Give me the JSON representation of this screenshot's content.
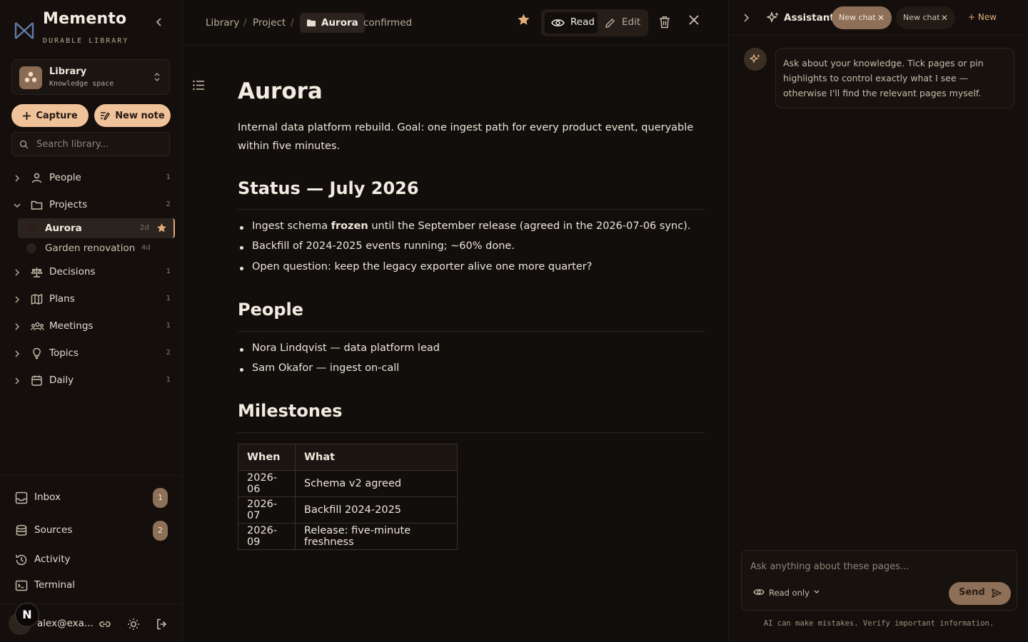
{
  "app": {
    "name": "Memento",
    "subtitle": "DURABLE LIBRARY"
  },
  "space": {
    "name": "Library",
    "type": "Knowledge space"
  },
  "actions": {
    "capture": "Capture",
    "new_note": "New note"
  },
  "search": {
    "placeholder": "Search library..."
  },
  "tree": {
    "people": {
      "label": "People",
      "count": "1"
    },
    "projects": {
      "label": "Projects",
      "count": "2"
    },
    "project_items": [
      {
        "label": "Aurora",
        "age": "2d"
      },
      {
        "label": "Garden renovation",
        "age": "4d"
      }
    ],
    "decisions": {
      "label": "Decisions",
      "count": "1"
    },
    "plans": {
      "label": "Plans",
      "count": "1"
    },
    "meetings": {
      "label": "Meetings",
      "count": "1"
    },
    "topics": {
      "label": "Topics",
      "count": "2"
    },
    "daily": {
      "label": "Daily",
      "count": "1"
    }
  },
  "bottom_nav": {
    "inbox": {
      "label": "Inbox",
      "badge": "1"
    },
    "sources": {
      "label": "Sources",
      "badge": "2"
    },
    "activity": {
      "label": "Activity"
    },
    "terminal": {
      "label": "Terminal"
    }
  },
  "user": {
    "email": "alex@exa...",
    "initial": "N"
  },
  "breadcrumb": {
    "library": "Library",
    "project": "Project",
    "current": "Aurora",
    "status": "confirmed"
  },
  "view_toggle": {
    "read": "Read",
    "edit": "Edit"
  },
  "document": {
    "title": "Aurora",
    "intro": "Internal data platform rebuild. Goal: one ingest path for every product event, queryable within five minutes.",
    "status_heading": "Status — July 2026",
    "status_items": [
      {
        "before": "Ingest schema ",
        "bold": "frozen",
        "after": " until the September release (agreed in the 2026-07-06 sync)."
      },
      {
        "before": "Backfill of 2024-2025 events running; ~60% done.",
        "bold": "",
        "after": ""
      },
      {
        "before": "Open question: keep the legacy exporter alive one more quarter?",
        "bold": "",
        "after": ""
      }
    ],
    "people_heading": "People",
    "people_items": [
      "Nora Lindqvist — data platform lead",
      "Sam Okafor — ingest on-call"
    ],
    "milestones_heading": "Milestones",
    "milestones_table": {
      "headers": [
        "When",
        "What"
      ],
      "rows": [
        [
          "2026-06",
          "Schema v2 agreed"
        ],
        [
          "2026-07",
          "Backfill 2024-2025"
        ],
        [
          "2026-09",
          "Release: five-minute freshness"
        ]
      ]
    }
  },
  "assistant": {
    "title": "Assistant",
    "tabs": [
      "New chat",
      "New chat"
    ],
    "new_label": "New",
    "greeting": "Ask about your knowledge. Tick pages or pin highlights to control exactly what I see — otherwise I'll find the relevant pages myself.",
    "input_placeholder": "Ask anything about these pages...",
    "mode": "Read only",
    "send": "Send",
    "disclaimer": "AI can make mistakes. Verify important information."
  },
  "colors": {
    "accent": "#f0c29a",
    "accent_dark": "#8e6f58",
    "background": "#120e0b",
    "star": "#e5ad79"
  }
}
